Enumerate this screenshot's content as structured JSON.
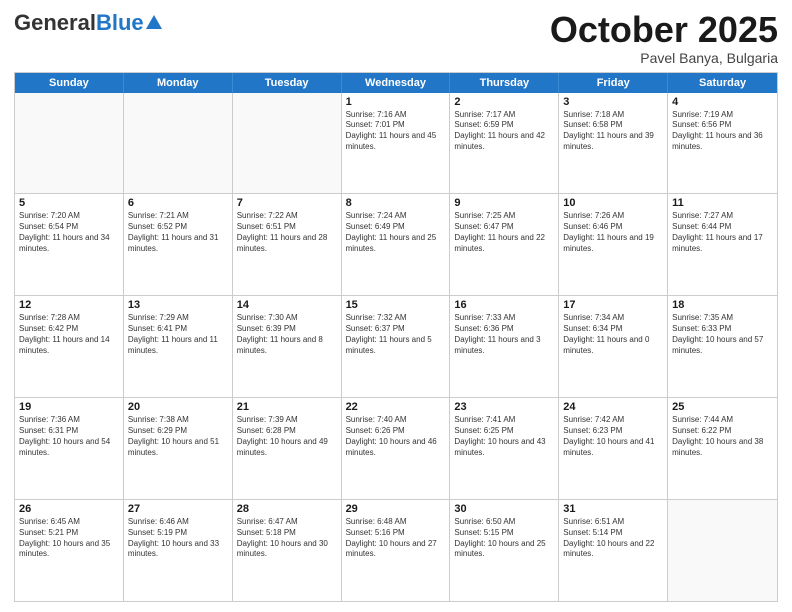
{
  "header": {
    "logo_general": "General",
    "logo_blue": "Blue",
    "month_title": "October 2025",
    "subtitle": "Pavel Banya, Bulgaria"
  },
  "days_of_week": [
    "Sunday",
    "Monday",
    "Tuesday",
    "Wednesday",
    "Thursday",
    "Friday",
    "Saturday"
  ],
  "weeks": [
    [
      {
        "day": "",
        "info": ""
      },
      {
        "day": "",
        "info": ""
      },
      {
        "day": "",
        "info": ""
      },
      {
        "day": "1",
        "info": "Sunrise: 7:16 AM\nSunset: 7:01 PM\nDaylight: 11 hours and 45 minutes."
      },
      {
        "day": "2",
        "info": "Sunrise: 7:17 AM\nSunset: 6:59 PM\nDaylight: 11 hours and 42 minutes."
      },
      {
        "day": "3",
        "info": "Sunrise: 7:18 AM\nSunset: 6:58 PM\nDaylight: 11 hours and 39 minutes."
      },
      {
        "day": "4",
        "info": "Sunrise: 7:19 AM\nSunset: 6:56 PM\nDaylight: 11 hours and 36 minutes."
      }
    ],
    [
      {
        "day": "5",
        "info": "Sunrise: 7:20 AM\nSunset: 6:54 PM\nDaylight: 11 hours and 34 minutes."
      },
      {
        "day": "6",
        "info": "Sunrise: 7:21 AM\nSunset: 6:52 PM\nDaylight: 11 hours and 31 minutes."
      },
      {
        "day": "7",
        "info": "Sunrise: 7:22 AM\nSunset: 6:51 PM\nDaylight: 11 hours and 28 minutes."
      },
      {
        "day": "8",
        "info": "Sunrise: 7:24 AM\nSunset: 6:49 PM\nDaylight: 11 hours and 25 minutes."
      },
      {
        "day": "9",
        "info": "Sunrise: 7:25 AM\nSunset: 6:47 PM\nDaylight: 11 hours and 22 minutes."
      },
      {
        "day": "10",
        "info": "Sunrise: 7:26 AM\nSunset: 6:46 PM\nDaylight: 11 hours and 19 minutes."
      },
      {
        "day": "11",
        "info": "Sunrise: 7:27 AM\nSunset: 6:44 PM\nDaylight: 11 hours and 17 minutes."
      }
    ],
    [
      {
        "day": "12",
        "info": "Sunrise: 7:28 AM\nSunset: 6:42 PM\nDaylight: 11 hours and 14 minutes."
      },
      {
        "day": "13",
        "info": "Sunrise: 7:29 AM\nSunset: 6:41 PM\nDaylight: 11 hours and 11 minutes."
      },
      {
        "day": "14",
        "info": "Sunrise: 7:30 AM\nSunset: 6:39 PM\nDaylight: 11 hours and 8 minutes."
      },
      {
        "day": "15",
        "info": "Sunrise: 7:32 AM\nSunset: 6:37 PM\nDaylight: 11 hours and 5 minutes."
      },
      {
        "day": "16",
        "info": "Sunrise: 7:33 AM\nSunset: 6:36 PM\nDaylight: 11 hours and 3 minutes."
      },
      {
        "day": "17",
        "info": "Sunrise: 7:34 AM\nSunset: 6:34 PM\nDaylight: 11 hours and 0 minutes."
      },
      {
        "day": "18",
        "info": "Sunrise: 7:35 AM\nSunset: 6:33 PM\nDaylight: 10 hours and 57 minutes."
      }
    ],
    [
      {
        "day": "19",
        "info": "Sunrise: 7:36 AM\nSunset: 6:31 PM\nDaylight: 10 hours and 54 minutes."
      },
      {
        "day": "20",
        "info": "Sunrise: 7:38 AM\nSunset: 6:29 PM\nDaylight: 10 hours and 51 minutes."
      },
      {
        "day": "21",
        "info": "Sunrise: 7:39 AM\nSunset: 6:28 PM\nDaylight: 10 hours and 49 minutes."
      },
      {
        "day": "22",
        "info": "Sunrise: 7:40 AM\nSunset: 6:26 PM\nDaylight: 10 hours and 46 minutes."
      },
      {
        "day": "23",
        "info": "Sunrise: 7:41 AM\nSunset: 6:25 PM\nDaylight: 10 hours and 43 minutes."
      },
      {
        "day": "24",
        "info": "Sunrise: 7:42 AM\nSunset: 6:23 PM\nDaylight: 10 hours and 41 minutes."
      },
      {
        "day": "25",
        "info": "Sunrise: 7:44 AM\nSunset: 6:22 PM\nDaylight: 10 hours and 38 minutes."
      }
    ],
    [
      {
        "day": "26",
        "info": "Sunrise: 6:45 AM\nSunset: 5:21 PM\nDaylight: 10 hours and 35 minutes."
      },
      {
        "day": "27",
        "info": "Sunrise: 6:46 AM\nSunset: 5:19 PM\nDaylight: 10 hours and 33 minutes."
      },
      {
        "day": "28",
        "info": "Sunrise: 6:47 AM\nSunset: 5:18 PM\nDaylight: 10 hours and 30 minutes."
      },
      {
        "day": "29",
        "info": "Sunrise: 6:48 AM\nSunset: 5:16 PM\nDaylight: 10 hours and 27 minutes."
      },
      {
        "day": "30",
        "info": "Sunrise: 6:50 AM\nSunset: 5:15 PM\nDaylight: 10 hours and 25 minutes."
      },
      {
        "day": "31",
        "info": "Sunrise: 6:51 AM\nSunset: 5:14 PM\nDaylight: 10 hours and 22 minutes."
      },
      {
        "day": "",
        "info": ""
      }
    ]
  ]
}
